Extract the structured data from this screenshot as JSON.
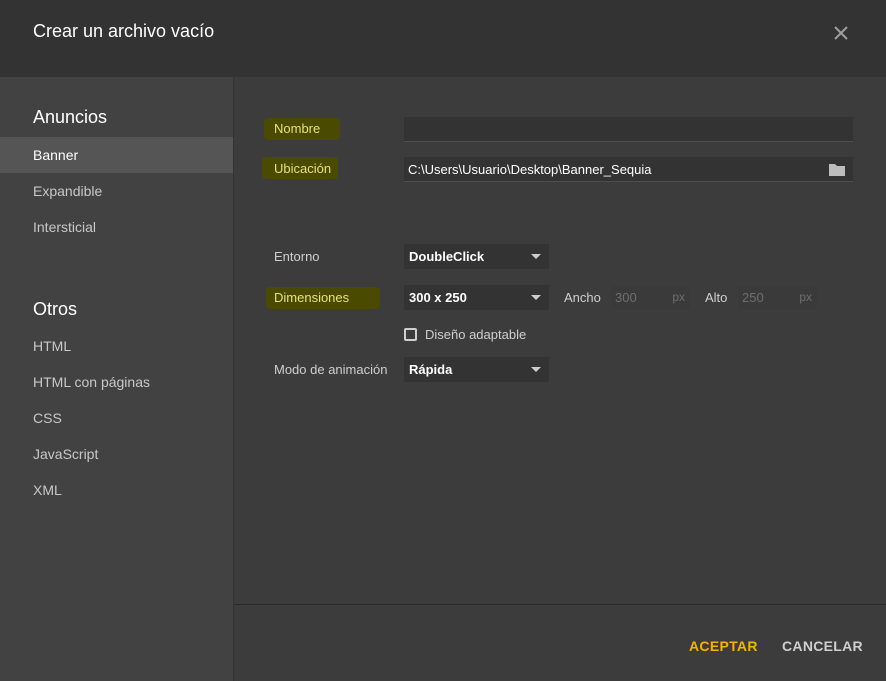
{
  "dialog": {
    "title": "Crear un archivo vacío"
  },
  "sidebar": {
    "section1": "Anuncios",
    "items1": [
      {
        "label": "Banner",
        "active": true
      },
      {
        "label": "Expandible",
        "active": false
      },
      {
        "label": "Intersticial",
        "active": false
      }
    ],
    "section2": "Otros",
    "items2": [
      {
        "label": "HTML"
      },
      {
        "label": "HTML con páginas"
      },
      {
        "label": "CSS"
      },
      {
        "label": "JavaScript"
      },
      {
        "label": "XML"
      }
    ]
  },
  "form": {
    "nombre_label": "Nombre",
    "nombre_value": "",
    "ubicacion_label": "Ubicación",
    "ubicacion_value": "C:\\Users\\Usuario\\Desktop\\Banner_Sequia",
    "entorno_label": "Entorno",
    "entorno_value": "DoubleClick",
    "dimensiones_label": "Dimensiones",
    "dimensiones_value": "300 x 250",
    "ancho_label": "Ancho",
    "ancho_value": "300",
    "alto_label": "Alto",
    "alto_value": "250",
    "unit": "px",
    "adaptable_label": "Diseño adaptable",
    "adaptable_checked": false,
    "modo_label": "Modo de animación",
    "modo_value": "Rápida"
  },
  "footer": {
    "accept": "ACEPTAR",
    "cancel": "CANCELAR"
  },
  "colors": {
    "accent": "#f5b400",
    "highlight": "#4a4a00"
  }
}
